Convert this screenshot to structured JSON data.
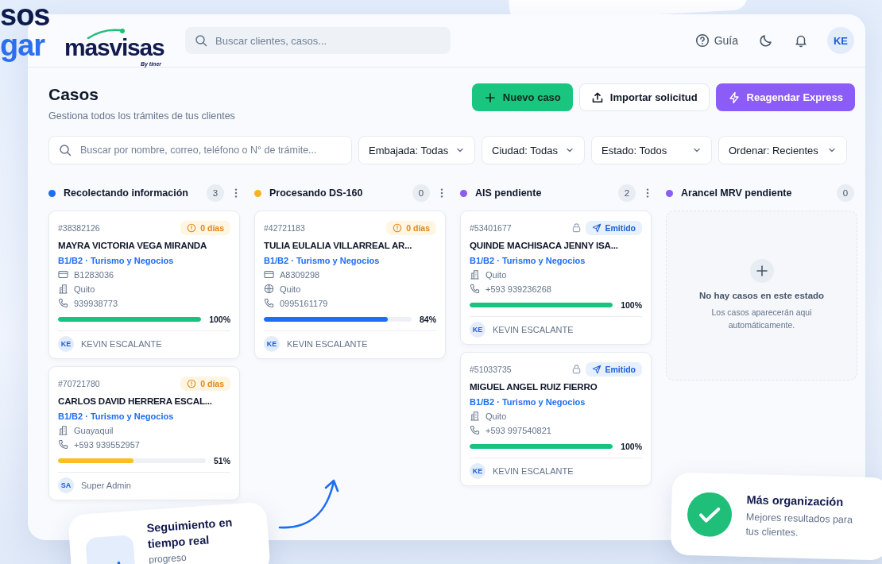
{
  "background_text": [
    "sos",
    "gar"
  ],
  "header": {
    "logo": {
      "name": "masvisas",
      "tagline": "By tiner"
    },
    "search": {
      "placeholder": "Buscar clientes, casos..."
    },
    "guide": "Guía",
    "avatar": "KE"
  },
  "page": {
    "title": "Casos",
    "subtitle": "Gestiona todos los trámites de tus clientes"
  },
  "actions": [
    {
      "label": "Nuevo caso",
      "kind": "primary"
    },
    {
      "label": "Importar solicitud",
      "kind": "import"
    },
    {
      "label": "Reagendar Express",
      "kind": "express"
    }
  ],
  "filters": {
    "search": {
      "placeholder": "Buscar por nombre, correo, teléfono o N° de trámite..."
    },
    "dropdowns": [
      "Embajada: Todas",
      "Ciudad: Todas",
      "Estado: Todos",
      "Ordenar: Recientes"
    ]
  },
  "columns": [
    {
      "title": "Recolectando información",
      "color": "#1d6ef5",
      "count": "3",
      "menu": true,
      "cards": [
        {
          "id": "#38382126",
          "badge": {
            "kind": "days",
            "label": "0 días"
          },
          "locked": false,
          "name": "MAYRA VICTORIA VEGA MIRANDA",
          "visa": "B1/B2 · Turismo y Negocios",
          "details": [
            {
              "kind": "document",
              "text": "B1283036"
            },
            {
              "kind": "building",
              "text": "Quito"
            },
            {
              "kind": "phone",
              "text": "939938773"
            }
          ],
          "progress": {
            "level": 1,
            "label": "100%",
            "color": "#16c47f"
          },
          "assignee": {
            "initials": "KE",
            "name": "KEVIN ESCALANTE"
          }
        },
        {
          "id": "#70721780",
          "badge": {
            "kind": "days",
            "label": "0 días"
          },
          "locked": false,
          "name": "CARLOS DAVID HERRERA ESCAL...",
          "visa": "B1/B2 · Turismo y Negocios",
          "details": [
            {
              "kind": "building",
              "text": "Guayaquil"
            },
            {
              "kind": "phone",
              "text": "+593 939552957"
            }
          ],
          "progress": {
            "level": 0.51,
            "label": "51%",
            "color": "#fbbf24"
          },
          "assignee": {
            "initials": "SA",
            "name": "Super Admin"
          }
        }
      ]
    },
    {
      "title": "Procesando DS-160",
      "color": "#fbb124",
      "count": "0",
      "menu": true,
      "cards": [
        {
          "id": "#42721183",
          "badge": {
            "kind": "days",
            "label": "0 días"
          },
          "locked": false,
          "name": "TULIA EULALIA VILLARREAL AR...",
          "visa": "B1/B2 · Turismo y Negocios",
          "details": [
            {
              "kind": "document",
              "text": "A8309298"
            },
            {
              "kind": "globe",
              "text": "Quito"
            },
            {
              "kind": "phone",
              "text": "0995161179"
            }
          ],
          "progress": {
            "level": 0.84,
            "label": "84%",
            "color": "#1d6ef5"
          },
          "assignee": {
            "initials": "KE",
            "name": "KEVIN ESCALANTE"
          }
        }
      ]
    },
    {
      "title": "AIS pendiente",
      "color": "#8b5cf6",
      "count": "2",
      "menu": true,
      "cards": [
        {
          "id": "#53401677",
          "badge": {
            "kind": "emitted",
            "label": "Emitido"
          },
          "locked": true,
          "name": "QUINDE MACHISACA JENNY ISA...",
          "visa": "B1/B2 · Turismo y Negocios",
          "details": [
            {
              "kind": "building",
              "text": "Quito"
            },
            {
              "kind": "phone",
              "text": "+593 939236268"
            }
          ],
          "progress": {
            "level": 1,
            "label": "100%",
            "color": "#16c47f"
          },
          "assignee": {
            "initials": "KE",
            "name": "KEVIN ESCALANTE"
          }
        },
        {
          "id": "#51033735",
          "badge": {
            "kind": "emitted",
            "label": "Emitido"
          },
          "locked": true,
          "name": "MIGUEL ANGEL RUIZ FIERRO",
          "visa": "B1/B2 · Turismo y Negocios",
          "details": [
            {
              "kind": "building",
              "text": "Quito"
            },
            {
              "kind": "phone",
              "text": "+593 997540821"
            }
          ],
          "progress": {
            "level": 1,
            "label": "100%",
            "color": "#16c47f"
          },
          "assignee": {
            "initials": "KE",
            "name": "KEVIN ESCALANTE"
          }
        }
      ]
    },
    {
      "title": "Arancel MRV pendiente",
      "color": "#8b5cf6",
      "count": "0",
      "menu": false,
      "empty": {
        "title": "No hay casos en este estado",
        "text": "Los casos aparecerán aqui automáticamente."
      }
    }
  ],
  "callouts": [
    {
      "kind": "chart",
      "title": "Seguimiento en tiempo real",
      "text": "progreso"
    },
    {
      "kind": "check",
      "title": "Más organización",
      "text": "Mejores resultados para tus clientes."
    }
  ]
}
